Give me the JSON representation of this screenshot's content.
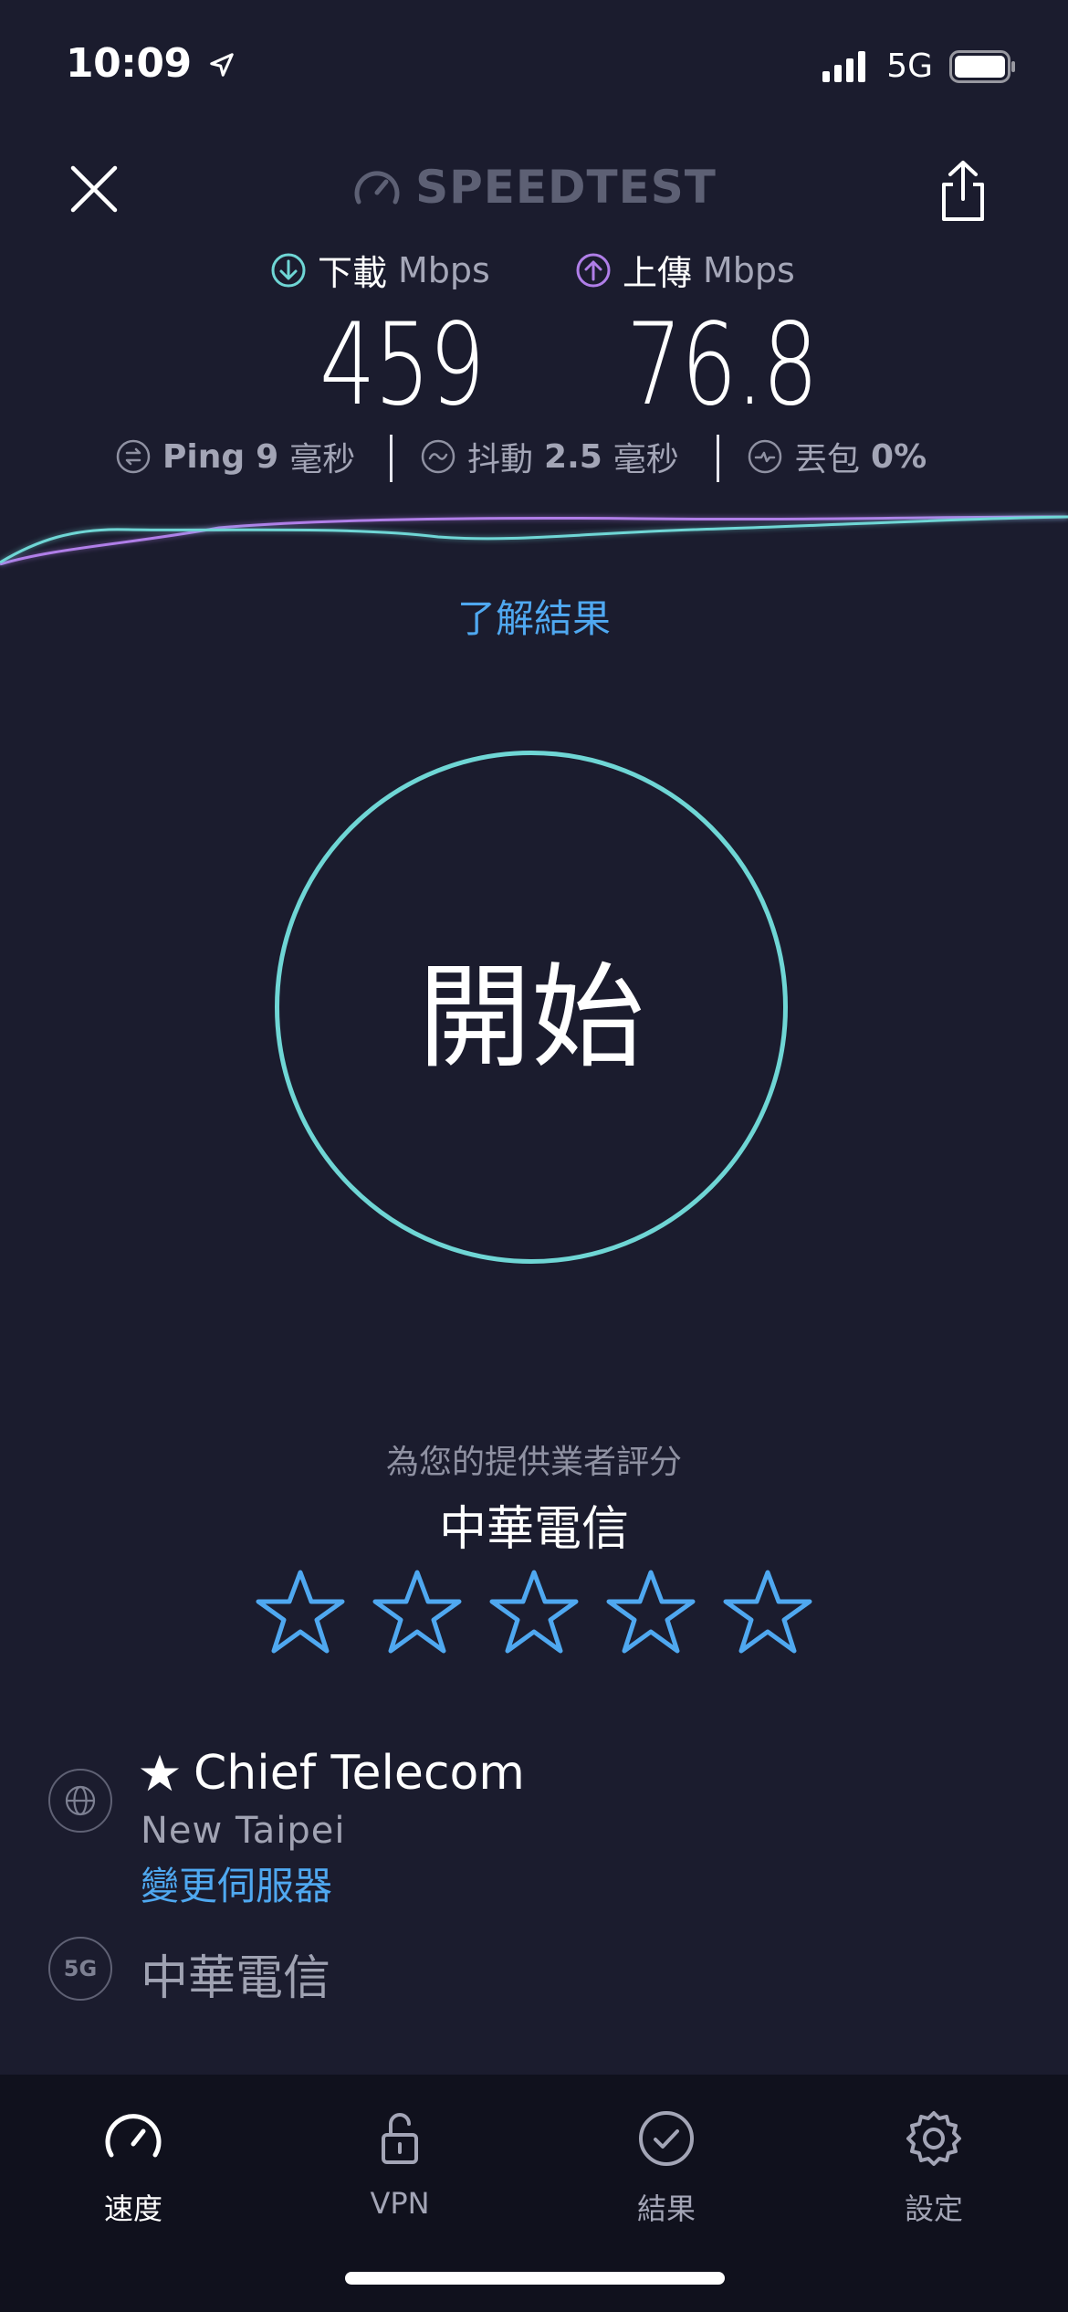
{
  "status_bar": {
    "time": "10:09",
    "network": "5G",
    "icons": [
      "location-arrow-icon",
      "signal-icon",
      "battery-icon"
    ]
  },
  "header": {
    "brand": "SPEEDTEST",
    "close_icon": "close-icon",
    "share_icon": "share-icon"
  },
  "results": {
    "download": {
      "label": "下載",
      "unit": "Mbps",
      "value": "459",
      "color": "#6fd6d5",
      "icon": "download-arrow-icon"
    },
    "upload": {
      "label": "上傳",
      "unit": "Mbps",
      "value": "76.8",
      "color": "#b07ee8",
      "icon": "upload-arrow-icon"
    },
    "ping": {
      "label": "Ping",
      "value": "9",
      "unit": "毫秒",
      "icon": "ping-icon"
    },
    "jitter": {
      "label": "抖動",
      "value": "2.5",
      "unit": "毫秒",
      "icon": "jitter-icon"
    },
    "packet_loss": {
      "label": "丟包",
      "value": "0%",
      "icon": "packet-loss-icon"
    }
  },
  "learn_more": "了解結果",
  "go_button": {
    "label": "開始",
    "ring_color": "#6fd6d5"
  },
  "rating": {
    "caption": "為您的提供業者評分",
    "provider": "中華電信",
    "stars_max": 5,
    "stars_selected": 0,
    "star_color": "#4fa8f0"
  },
  "server": {
    "name": "Chief Telecom",
    "location": "New Taipei",
    "change_label": "變更伺服器",
    "network_badge": "5G",
    "carrier": "中華電信"
  },
  "tabs": [
    {
      "label": "速度",
      "icon": "speedometer-icon",
      "active": true
    },
    {
      "label": "VPN",
      "icon": "unlock-icon",
      "active": false
    },
    {
      "label": "結果",
      "icon": "check-circle-icon",
      "active": false
    },
    {
      "label": "設定",
      "icon": "gear-icon",
      "active": false
    }
  ]
}
